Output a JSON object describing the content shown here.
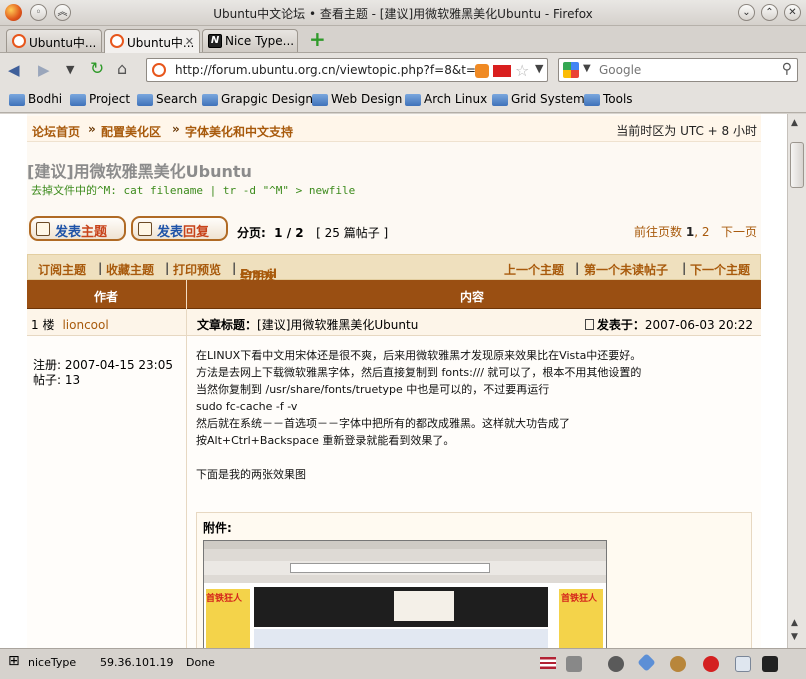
{
  "window": {
    "title": "Ubuntu中文论坛 • 查看主题 - [建议]用微软雅黑美化Ubuntu - Firefox"
  },
  "tabs": [
    {
      "label": "Ubuntu中..."
    },
    {
      "label": "Ubuntu中..."
    },
    {
      "label": "Nice Type..."
    }
  ],
  "nav": {
    "url": "http://forum.ubuntu.org.cn/viewtopic.php?f=8&t=5815",
    "search_placeholder": "Google"
  },
  "bookmarks": [
    "Bodhi",
    "Project",
    "Search",
    "Grapgic Design",
    "Web Design",
    "Arch Linux",
    "Grid System",
    "Tools"
  ],
  "breadcrumb": {
    "home": "论坛首页",
    "sep": "»",
    "section": "配置美化区",
    "subsection": "字体美化和中文支持",
    "timezone": "当前时区为 UTC + 8 小时"
  },
  "topic": {
    "title": "[建议]用微软雅黑美化Ubuntu",
    "subtitle": "去掉文件中的^M: cat filename | tr -d \"^M\" > newfile"
  },
  "controls": {
    "new_topic_a": "发表",
    "new_topic_b": "主题",
    "reply_a": "发表",
    "reply_b": "回复",
    "pages_label": "分页:",
    "pages_value": "1 / 2",
    "posts_count": "[ 25 篇帖子 ]",
    "goto_label": "前往页数",
    "page_current": "1",
    "page_comma": ",",
    "page_2": "2",
    "next": "下一页"
  },
  "actions": {
    "subscribe": "订阅主题",
    "bookmark": "收藏主题",
    "print": "打印预览",
    "email_a": "Email",
    "email_b": "给朋友",
    "prev_topic": "上一个主题",
    "first_unread": "第一个未读帖子",
    "next_topic": "下一个主题",
    "bar": "|"
  },
  "table": {
    "author_header": "作者",
    "content_header": "内容"
  },
  "post": {
    "floor": "1 楼",
    "author": "lioncool",
    "subject_label": "文章标题：",
    "subject": "[建议]用微软雅黑美化Ubuntu",
    "posted_label": "发表于：",
    "posted": "2007-06-03 20:22",
    "register": "注册: 2007-04-15 23:05",
    "post_count": "帖子: 13",
    "lines": [
      "在LINUX下看中文用宋体还是很不爽，后来用微软雅黑才发现原来效果比在Vista中还要好。",
      "方法是去网上下载微软雅黑字体，然后直接复制到 fonts:/// 就可以了，根本不用其他设置的",
      "当然你复制到 /usr/share/fonts/truetype 中也是可以的，不过要再运行",
      "sudo fc-cache -f -v",
      "然后就在系统－－首选项－－字体中把所有的都改成雅黑。这样就大功告成了",
      "按Alt+Ctrl+Backspace 重新登录就能看到效果了。",
      "",
      "下面是我的两张效果图"
    ],
    "attachment_label": "附件:",
    "shot_text_left": "首铁狂人",
    "shot_text_right": "首铁狂人"
  },
  "status": {
    "extension": "niceType",
    "ip": "59.36.101.19",
    "state": "Done"
  }
}
